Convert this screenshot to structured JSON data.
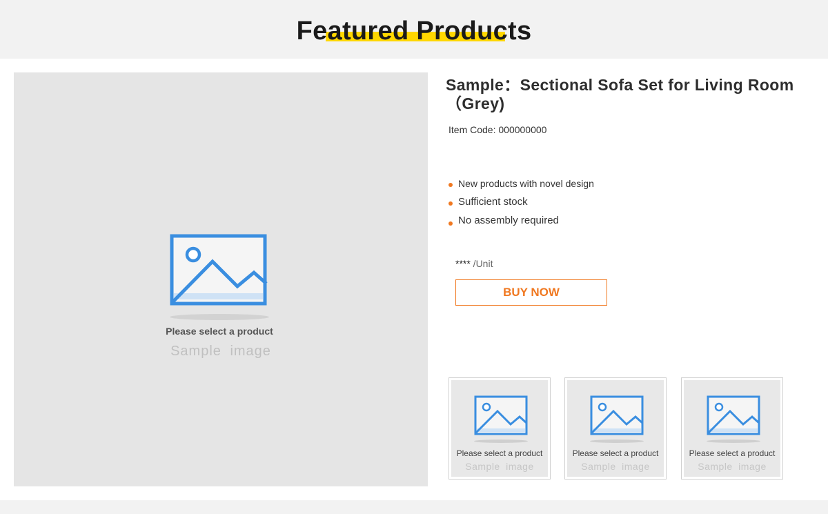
{
  "header": {
    "title": "Featured Products"
  },
  "main_image": {
    "icon": "image-placeholder-icon",
    "caption": "Please select a product",
    "sample_label": "Sample  image"
  },
  "product": {
    "title": "Sample：Sectional Sofa Set for Living Room （Grey)",
    "item_code": "Item Code: 000000000",
    "features": [
      "New products with novel design",
      "Sufficient stock",
      "No assembly required"
    ],
    "price": "****",
    "price_unit": " /Unit",
    "buy_label": "BUY NOW"
  },
  "thumbnails": [
    {
      "icon": "image-placeholder-icon",
      "caption": "Please select a product",
      "sample_label": "Sample  image"
    },
    {
      "icon": "image-placeholder-icon",
      "caption": "Please select a product",
      "sample_label": "Sample  image"
    },
    {
      "icon": "image-placeholder-icon",
      "caption": "Please select a product",
      "sample_label": "Sample  image"
    }
  ],
  "colors": {
    "accent": "#f07820",
    "highlight": "#ffd700",
    "icon_blue": "#3a8ee0",
    "placeholder_bg": "#e5e5e5"
  }
}
